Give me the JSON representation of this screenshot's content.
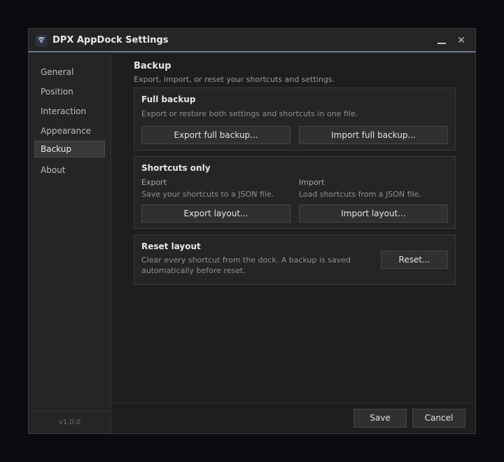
{
  "window": {
    "title": "DPX AppDock Settings",
    "minimize_label": "",
    "close_label": "✕"
  },
  "sidebar": {
    "items": [
      {
        "label": "General"
      },
      {
        "label": "Position"
      },
      {
        "label": "Interaction"
      },
      {
        "label": "Appearance"
      },
      {
        "label": "Backup",
        "active": true
      },
      {
        "label": "About"
      }
    ],
    "version": "v1.0.0"
  },
  "page": {
    "title": "Backup",
    "subtitle": "Export, import, or reset your shortcuts and settings."
  },
  "full_backup": {
    "title": "Full backup",
    "description": "Export or restore both settings and shortcuts in one file.",
    "export_label": "Export full backup...",
    "import_label": "Import full backup..."
  },
  "shortcuts_only": {
    "title": "Shortcuts only",
    "export_heading": "Export",
    "export_description": "Save your shortcuts to a JSON file.",
    "import_heading": "Import",
    "import_description": "Load shortcuts from a JSON file.",
    "export_label": "Export layout...",
    "import_label": "Import layout..."
  },
  "reset_layout": {
    "title": "Reset layout",
    "description_line1": "Clear every shortcut from the dock. A backup is saved",
    "description_line2": "automatically before reset.",
    "reset_label": "Reset..."
  },
  "footer": {
    "save_label": "Save",
    "cancel_label": "Cancel"
  },
  "colors": {
    "accent_line": "#6e7c96",
    "window_bg": "#1e1e1e",
    "card_bg": "#252525"
  }
}
